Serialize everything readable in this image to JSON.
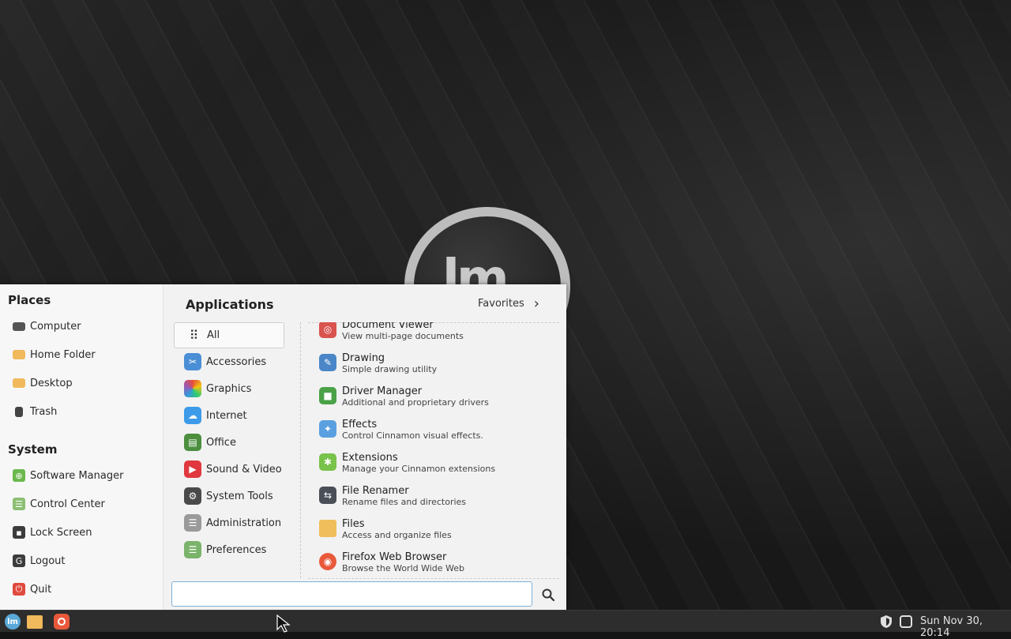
{
  "desktop": {
    "logo_text": "lm"
  },
  "menu": {
    "places": {
      "title": "Places",
      "items": [
        {
          "label": "Computer",
          "icon": "computer-icon"
        },
        {
          "label": "Home Folder",
          "icon": "home-folder-icon"
        },
        {
          "label": "Desktop",
          "icon": "desktop-folder-icon"
        },
        {
          "label": "Trash",
          "icon": "trash-icon"
        }
      ]
    },
    "system": {
      "title": "System",
      "items": [
        {
          "label": "Software Manager",
          "icon": "software-manager-icon"
        },
        {
          "label": "Control Center",
          "icon": "control-center-icon"
        },
        {
          "label": "Lock Screen",
          "icon": "lock-icon"
        },
        {
          "label": "Logout",
          "icon": "logout-icon"
        },
        {
          "label": "Quit",
          "icon": "power-icon"
        }
      ]
    },
    "applications_title": "Applications",
    "favorites_label": "Favorites",
    "categories": [
      {
        "label": "All",
        "selected": true
      },
      {
        "label": "Accessories"
      },
      {
        "label": "Graphics"
      },
      {
        "label": "Internet"
      },
      {
        "label": "Office"
      },
      {
        "label": "Sound & Video"
      },
      {
        "label": "System Tools"
      },
      {
        "label": "Administration"
      },
      {
        "label": "Preferences"
      }
    ],
    "apps": [
      {
        "name": "Document Viewer",
        "desc": "View multi-page documents"
      },
      {
        "name": "Drawing",
        "desc": "Simple drawing utility"
      },
      {
        "name": "Driver Manager",
        "desc": "Additional and proprietary drivers"
      },
      {
        "name": "Effects",
        "desc": "Control Cinnamon visual effects."
      },
      {
        "name": "Extensions",
        "desc": "Manage your Cinnamon extensions"
      },
      {
        "name": "File Renamer",
        "desc": "Rename files and directories"
      },
      {
        "name": "Files",
        "desc": "Access and organize files"
      },
      {
        "name": "Firefox Web Browser",
        "desc": "Browse the World Wide Web"
      }
    ],
    "search": {
      "value": "",
      "placeholder": ""
    }
  },
  "taskbar": {
    "clock": "Sun Nov 30, 20:14"
  },
  "colors": {
    "menu_bg": "#f2f2f2",
    "taskbar_bg": "#2d2d2d",
    "accent": "#7fb0d8"
  }
}
